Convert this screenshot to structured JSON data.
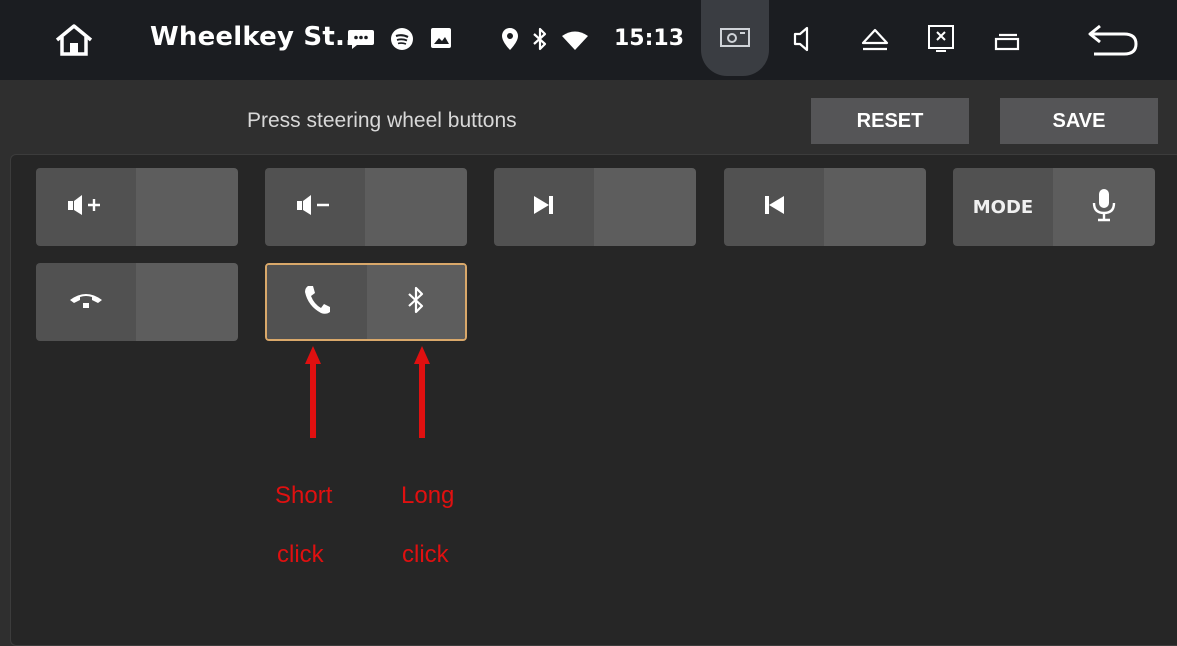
{
  "status_bar": {
    "title": "Wheelkey St...",
    "time": "15:13",
    "icons": [
      "home-icon",
      "message-icon",
      "spotify-icon",
      "image-icon",
      "location-icon",
      "bluetooth-icon",
      "wifi-icon",
      "screenshot-icon",
      "volume-icon",
      "eject-icon",
      "close-window-icon",
      "recent-apps-icon",
      "back-icon"
    ]
  },
  "header": {
    "instruction": "Press steering wheel buttons",
    "reset_label": "RESET",
    "save_label": "SAVE"
  },
  "keys": [
    {
      "name": "volume-up",
      "left_icon": "volume-up-icon",
      "right": ""
    },
    {
      "name": "volume-down",
      "left_icon": "volume-down-icon",
      "right": ""
    },
    {
      "name": "next-track",
      "left_icon": "next-track-icon",
      "right": ""
    },
    {
      "name": "previous-track",
      "left_icon": "previous-track-icon",
      "right": ""
    },
    {
      "name": "mode",
      "left_label": "MODE",
      "right_icon": "microphone-icon"
    },
    {
      "name": "hang-up",
      "left_icon": "hang-up-icon",
      "right": ""
    },
    {
      "name": "phone-bluetooth",
      "left_icon": "phone-icon",
      "right_icon": "bluetooth-icon",
      "selected": true
    }
  ],
  "annotations": {
    "short_line1": "Short",
    "short_line2": "click",
    "long_line1": "Long",
    "long_line2": "click"
  },
  "colors": {
    "accent_border": "#d9a86a",
    "annotation_red": "#e01010"
  }
}
